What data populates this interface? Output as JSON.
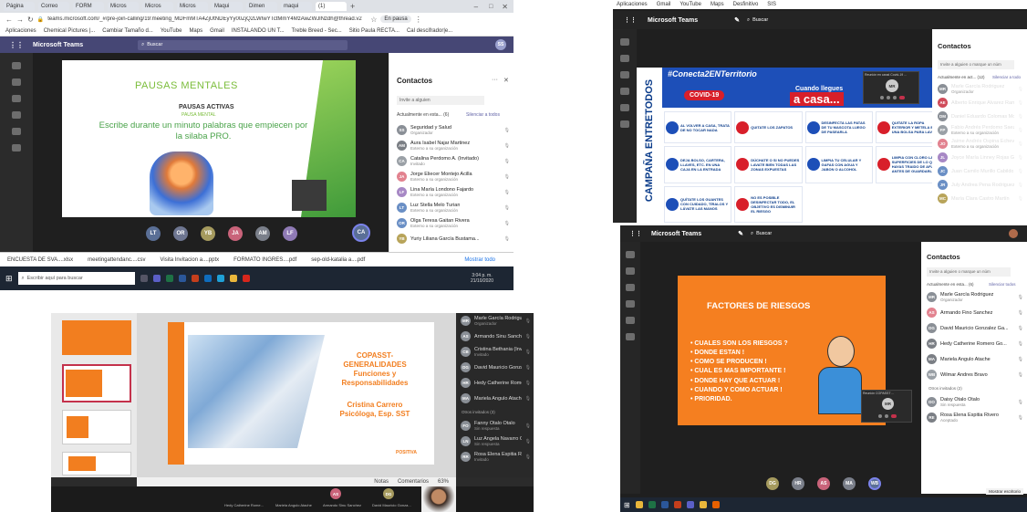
{
  "browser": {
    "tabs": [
      "Página",
      "Correo",
      "FORM",
      "Micros",
      "Micros",
      "Micros",
      "Maqui",
      "Dimen",
      "maqui",
      "(1)"
    ],
    "url": "teams.microsoft.com/_#/pre-join-calling/19:meeting_MDFmMTA4ZjUtNDEyYy00ZjQ2LWIwYTctMmY4MzAwZWJlNzdh@thread.v2",
    "bookmarks": [
      "Aplicaciones",
      "Chemical Pictures |...",
      "Cambiar Tamaño d...",
      "YouTube",
      "Maps",
      "Gmail",
      "INSTALANDO UN T...",
      "Treble Breed - Sec...",
      "Sitio Paula RECTA...",
      "Cal descifrador|e..."
    ],
    "profile_label": "En pausa"
  },
  "teams": {
    "app_title": "Microsoft Teams",
    "search_placeholder": "Buscar",
    "user_initials": "SS"
  },
  "panel1": {
    "slide_title": "PAUSAS MENTALES",
    "slide_subtitle": "PAUSAS ACTIVAS",
    "slide_subtitle2": "PAUSA MENTAL",
    "slide_body": "Escribe durante un minuto palabras que empiecen por la silaba PRO.",
    "participants": [
      "LT",
      "OR",
      "YB",
      "JA",
      "AM",
      "LF",
      "CA"
    ],
    "contacts_title": "Contactos",
    "invite_placeholder": "Invite a alguien",
    "section_label": "Actualmente en esta... (6)",
    "mute_all": "Silenciar a todos",
    "contacts": [
      {
        "initials": "SS",
        "name": "Seguridad y Salud",
        "sub": "Organizador",
        "color": "#8a8f96"
      },
      {
        "initials": "AM",
        "name": "Aura Isabel Najar Martinez",
        "sub": "Externo a su organización",
        "color": "#7b7f85"
      },
      {
        "initials": "CA",
        "name": "Catalina Perdomo A. (Invitado)",
        "sub": "Invitado",
        "color": "#9aa0a6"
      },
      {
        "initials": "JA",
        "name": "Jorge Eliecer Montejo Acilla",
        "sub": "Externo a su organización",
        "color": "#e2828f"
      },
      {
        "initials": "LF",
        "name": "Lina María Londono Fajardo",
        "sub": "Externo a su organización",
        "color": "#a788c5"
      },
      {
        "initials": "LT",
        "name": "Luz Stella Melo Turian",
        "sub": "Externo a su organización",
        "color": "#6a8fc5"
      },
      {
        "initials": "OR",
        "name": "Olga Teresa Gaitan Rivera",
        "sub": "Externo a su organización",
        "color": "#6a8fc5"
      },
      {
        "initials": "YB",
        "name": "Yuriy Liliana García Bustama...",
        "sub": "",
        "color": "#b8a45a"
      }
    ],
    "downloads": [
      "ENCUESTA DE SVA....xlsx",
      "meetingattendanc....csv",
      "Visita Invitacion a....pptx",
      "FORMATO INGRES....pdf",
      "sep-old-katalia a....pdf"
    ],
    "show_all": "Mostrar todo",
    "taskbar_search": "Escribir aquí para buscar",
    "clock_time": "3:04 p. m.",
    "clock_date": "21/10/2020"
  },
  "panel2": {
    "bookmarks": [
      "Aplicaciones",
      "Gmail",
      "YouTube",
      "Maps",
      "Desfinitivo",
      "SIS"
    ],
    "hashtag": "#Conecta2ENTerritorio",
    "vertical": "CAMPAÑA ENTRETODOS",
    "banner_left": "COVID-19",
    "banner_top": "Cuando llegues",
    "banner_big": "a casa...",
    "steps": [
      "AL VOLVER A CASA, TRATA DE NO TOCAR NADA",
      "QUITATE LOS ZAPATOS",
      "DESINFECTA LAS PATAS DE TU MASCOTA LUEGO DE PASEARLA",
      "QUITATE LA ROPA EXTERIOR Y METELA EN UNA BOLSA PARA LAVAR",
      "DEJA BOLSO, CARTERA, LLAVES, ETC. EN UNA CAJA EN LA ENTRADA",
      "DÚCHATE O SI NO PUEDES LAVATE BIEN TODAS LAS ZONAS EXPUESTAS",
      "LIMPIA TU CELULAR Y GAFAS CON AGUA Y JABON O ALCOHOL",
      "LIMPIA CON CLORO LAS SUPERFICIES DE LO QUE HAYAS TRAIDO DE AFUERA ANTES DE GUARDARLO",
      "QUÍTATE LOS GUANTES CON CUIDADO, TÍRALOS Y LÁVATE LAS MANOS",
      "NO ES POSIBLE DESINFECTAR TODO, EL OBJETIVO ES DISMINUIR EL RIESGO"
    ],
    "footer": "entretodos",
    "pip_label": "Reunión en canal Covid-19 ...",
    "pip_initials": "MR",
    "contacts_title": "Contactos",
    "invite_placeholder": "Invite a alguien o marque un núm",
    "section_label": "Actualmente en act... (12)",
    "mute_all": "Silenciar a todo",
    "contacts": [
      {
        "initials": "MR",
        "name": "Marle García Rodriguez",
        "sub": "Organizador",
        "color": "#8a8f96"
      },
      {
        "initials": "AE",
        "name": "Alberto Enrique Alvarez Ram...",
        "sub": "",
        "color": "#d04b5a"
      },
      {
        "initials": "DM",
        "name": "Daniel Eduardo Colomas Mo...",
        "sub": "",
        "color": "#8a8f96"
      },
      {
        "initials": "FP",
        "name": "Fabio Andrés Perdomo Saez",
        "sub": "Externo a su organización",
        "color": "#9aa0a6"
      },
      {
        "initials": "JO",
        "name": "Jaime Andrés Ospina Echeve...",
        "sub": "Externo a su organización",
        "color": "#e2828f"
      },
      {
        "initials": "JL",
        "name": "Joyce María Linney Rojas Go...",
        "sub": "",
        "color": "#a788c5"
      },
      {
        "initials": "JC",
        "name": "Juan Camilo Murillo Cabildo",
        "sub": "",
        "color": "#6a8fc5"
      },
      {
        "initials": "JR",
        "name": "July Andrea Pena Rodriguez",
        "sub": "",
        "color": "#6a8fc5"
      },
      {
        "initials": "MC",
        "name": "María Clara Castro Martín",
        "sub": "",
        "color": "#b8a45a"
      }
    ]
  },
  "panel3": {
    "title_line1": "COPASST-",
    "title_line2": "GENERALIDADES",
    "title_line3": "Funciones y",
    "title_line4": "Responsabilidades",
    "presenter": "Cristina Carrero",
    "presenter_role": "Psicóloga, Esp. SST",
    "brand": "POSITIVA",
    "contacts": [
      {
        "initials": "MR",
        "name": "Marle García Rodriguez",
        "sub": "Organizador"
      },
      {
        "initials": "AS",
        "name": "Armando Sinu Sanchez",
        "sub": ""
      },
      {
        "initials": "CB",
        "name": "Cristina Bethania (Invitado)",
        "sub": "Invitado"
      },
      {
        "initials": "DG",
        "name": "David Mauricio Gonzalez Garcia",
        "sub": ""
      },
      {
        "initials": "HR",
        "name": "Hedy Catherine Romero Conde...",
        "sub": ""
      },
      {
        "initials": "MA",
        "name": "Mariela Angulo Atache",
        "sub": ""
      }
    ],
    "others_label": "Otros invitados (3)",
    "others": [
      {
        "initials": "FO",
        "name": "Fanny Otalo Otalo",
        "sub": "Sin respuesta"
      },
      {
        "initials": "LN",
        "name": "Luz Angela Navarro Gonzalez",
        "sub": "Sin respuesta"
      },
      {
        "initials": "RR",
        "name": "Rosa Elena Espitia Rivera",
        "sub": "Invitado"
      }
    ],
    "notes_label": "Notas",
    "comments_label": "Comentarios",
    "zoom": "63%",
    "bottom_names": [
      "Hedy Catherine Rome...",
      "Mariela Angulo Atache",
      "Armando Sinu Sanchez",
      "David Mauricio Gonza..."
    ],
    "bottom_initials": [
      "AS",
      "DG"
    ]
  },
  "panel4": {
    "app_title": "Microsoft Teams",
    "search_placeholder": "Buscar",
    "slide_title": "FACTORES DE RIESGOS",
    "items": [
      "CUALES SON LOS RIESGOS ?",
      "DONDE ESTAN !",
      "COMO SE PRODUCEN !",
      "CUAL ES MAS IMPORTANTE !",
      "DONDE HAY QUE ACTUAR !",
      "CUANDO Y COMO ACTUAR !",
      "PRIORIDAD."
    ],
    "pip_label": "Reunión COPASST ...",
    "pip_initials": "MR",
    "contacts_title": "Contactos",
    "invite_placeholder": "Invite a alguien o marque un núm",
    "section_label": "Actualmente en esta... (6)",
    "mute_all": "Silenciar todos",
    "contacts": [
      {
        "initials": "MR",
        "name": "Marle García Rodriguez",
        "sub": "Organizador",
        "color": "#8a8f96"
      },
      {
        "initials": "AS",
        "name": "Armando Fino Sanchez",
        "sub": "",
        "color": "#e2828f"
      },
      {
        "initials": "DG",
        "name": "David Mauricio Gonzalez Ga...",
        "sub": "",
        "color": "#8a8f96"
      },
      {
        "initials": "HR",
        "name": "Hedy Catherine Romero Go...",
        "sub": "",
        "color": "#7b7f85"
      },
      {
        "initials": "MA",
        "name": "Mariela Angulo Atache",
        "sub": "",
        "color": "#7b7f85"
      },
      {
        "initials": "WB",
        "name": "Wilmar Andres Bravo",
        "sub": "",
        "color": "#9aa0a6"
      }
    ],
    "others_label": "Otros invitados (2)",
    "others": [
      {
        "initials": "DO",
        "name": "Daisy Otalo Otalo",
        "sub": "Sin respuesta",
        "color": "#8a8f96"
      },
      {
        "initials": "RE",
        "name": "Rosa Elena Espitia Rivero",
        "sub": "Aceptado",
        "color": "#7b7f85"
      }
    ],
    "participants": [
      "DG",
      "HR",
      "AS",
      "MA",
      "WB"
    ],
    "show_desktop": "Mostrar escritorio"
  }
}
